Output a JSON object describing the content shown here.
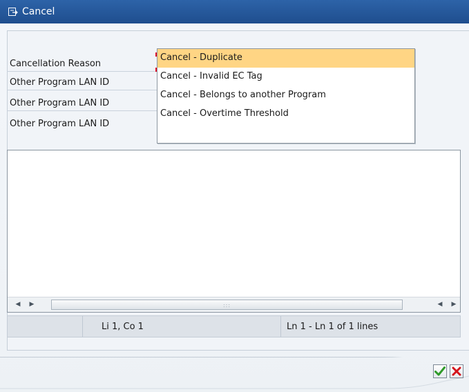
{
  "window": {
    "title": "Cancel"
  },
  "form": {
    "labels": [
      "Cancellation Reason",
      "Other Program LAN ID",
      "Other Program LAN ID",
      "Other Program LAN ID"
    ],
    "reason_value": ""
  },
  "dropdown": {
    "options": [
      "Cancel - Duplicate",
      "Cancel - Invalid EC Tag",
      "Cancel - Belongs to another Program",
      "Cancel - Overtime Threshold"
    ],
    "selected_index": 0
  },
  "statusbar": {
    "cursor": "Li 1, Co 1",
    "lines": "Ln 1 - Ln 1 of 1 lines"
  },
  "buttons": {
    "confirm_icon": "check-icon",
    "cancel_icon": "x-icon"
  },
  "colors": {
    "titlebar": "#2d63a8",
    "required_input": "#fff7b8",
    "selected_option": "#ffd584",
    "confirm_green": "#2f9a2a",
    "cancel_red": "#d4141c"
  }
}
